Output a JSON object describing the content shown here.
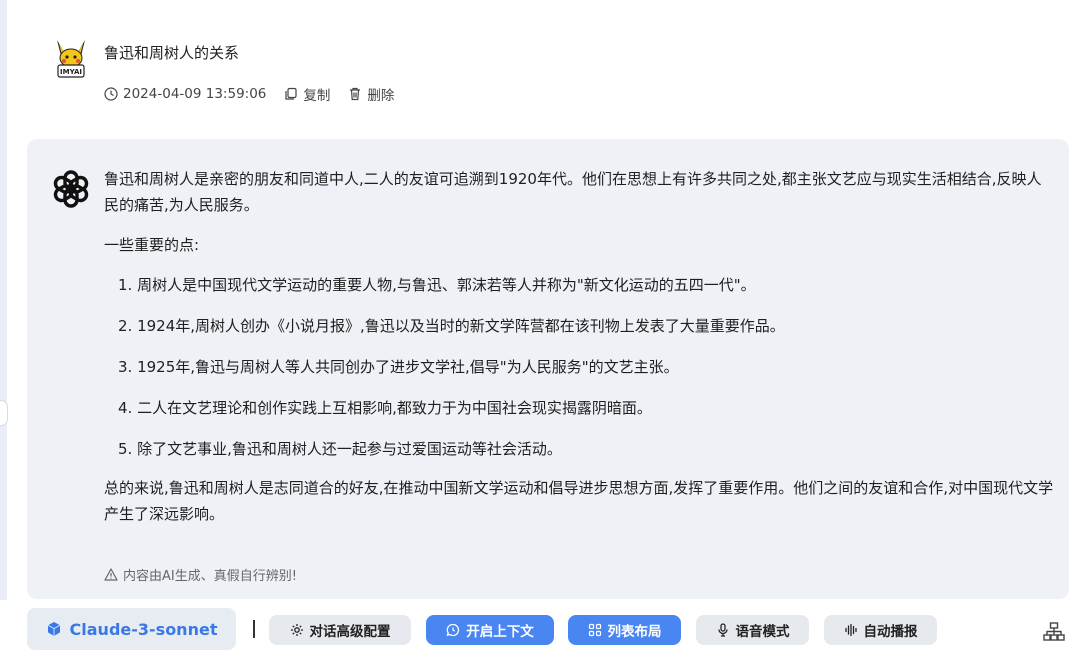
{
  "user_message": {
    "title": "鲁迅和周树人的关系",
    "timestamp": "2024-04-09 13:59:06",
    "copy_label": "复制",
    "delete_label": "删除",
    "avatar_label": "IMYAI"
  },
  "ai_message": {
    "intro": "鲁迅和周树人是亲密的朋友和同道中人,二人的友谊可追溯到1920年代。他们在思想上有许多共同之处,都主张文艺应与现实生活相结合,反映人民的痛苦,为人民服务。",
    "points_heading": "一些重要的点:",
    "points": [
      "1. 周树人是中国现代文学运动的重要人物,与鲁迅、郭沫若等人并称为\"新文化运动的五四一代\"。",
      "2. 1924年,周树人创办《小说月报》,鲁迅以及当时的新文学阵营都在该刊物上发表了大量重要作品。",
      "3. 1925年,鲁迅与周树人等人共同创办了进步文学社,倡导\"为人民服务\"的文艺主张。",
      "4. 二人在文艺理论和创作实践上互相影响,都致力于为中国社会现实揭露阴暗面。",
      "5. 除了文艺事业,鲁迅和周树人还一起参与过爱国运动等社会活动。"
    ],
    "summary": "总的来说,鲁迅和周树人是志同道合的好友,在推动中国新文学运动和倡导进步思想方面,发挥了重要作用。他们之间的友谊和合作,对中国现代文学产生了深远影响。",
    "disclaimer": "内容由AI生成、真假自行辨别!"
  },
  "toolbar": {
    "model": "Claude-3-sonnet",
    "advanced_config": "对话高级配置",
    "enable_context": "开启上下文",
    "list_layout": "列表布局",
    "voice_mode": "语音模式",
    "auto_play": "自动播报"
  },
  "colors": {
    "accent": "#4a86f2",
    "model_text": "#3a78e6",
    "card_bg": "#eef1f6",
    "grey_button": "#e6e9ee"
  },
  "icons": [
    "clock-icon",
    "copy-icon",
    "trash-icon",
    "warning-icon",
    "cube-icon",
    "gear-icon",
    "chat-bubble-icon",
    "grid-icon",
    "microphone-icon",
    "audio-wave-icon",
    "sitemap-icon",
    "openai-logo-icon"
  ]
}
